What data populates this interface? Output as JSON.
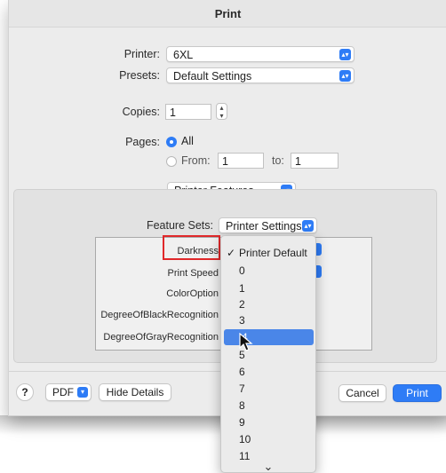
{
  "window": {
    "title": "Print"
  },
  "printer": {
    "label": "Printer:",
    "value": "6XL"
  },
  "presets": {
    "label": "Presets:",
    "value": "Default Settings"
  },
  "copies": {
    "label": "Copies:",
    "value": "1"
  },
  "pages": {
    "label": "Pages:",
    "all_label": "All",
    "from_label": "From:",
    "from_value": "1",
    "to_label": "to:",
    "to_value": "1"
  },
  "section_popup": {
    "value": "Printer Features"
  },
  "feature_sets": {
    "label": "Feature Sets:",
    "value": "Printer Settings"
  },
  "feature_rows": [
    {
      "label": "Darkness"
    },
    {
      "label": "Print Speed"
    },
    {
      "label": "ColorOption"
    },
    {
      "label": "DegreeOfBlackRecognition"
    },
    {
      "label": "DegreeOfGrayRecognition"
    }
  ],
  "dropdown": {
    "items": [
      "Printer Default",
      "0",
      "1",
      "2",
      "3",
      "4",
      "5",
      "6",
      "7",
      "8",
      "9",
      "10",
      "11"
    ],
    "checked_item": "Printer Default",
    "highlighted_item": "4",
    "scroll_indicator": "⌄"
  },
  "footer": {
    "help_label": "?",
    "pdf_label": "PDF",
    "hide_details_label": "Hide Details",
    "cancel_label": "Cancel",
    "print_label": "Print"
  },
  "colors": {
    "accent": "#2e7cf6",
    "highlight": "#4a86e8",
    "annotation": "#e0282a"
  }
}
